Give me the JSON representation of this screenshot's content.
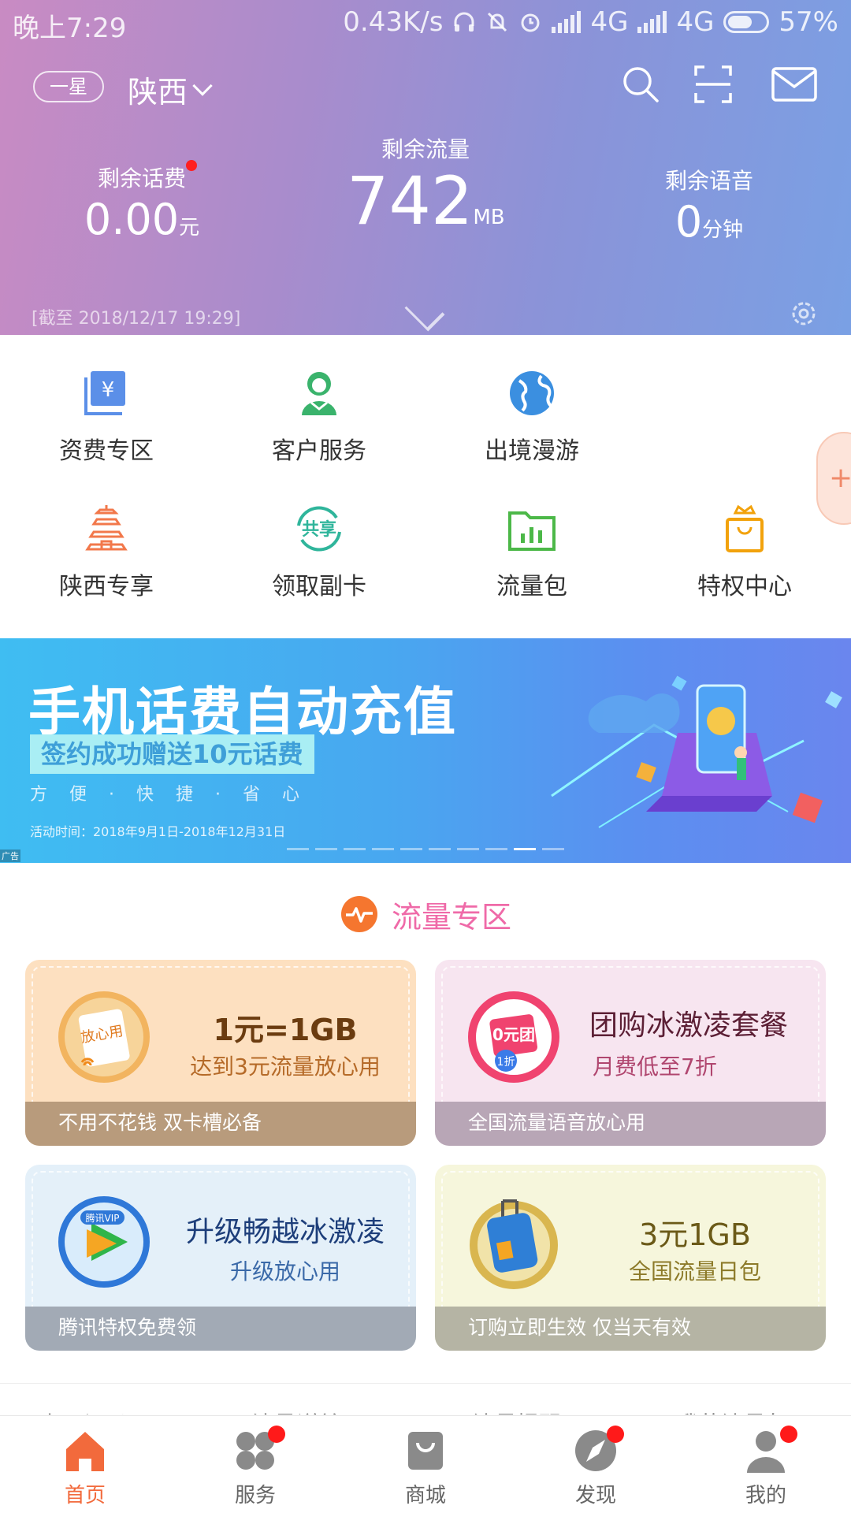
{
  "status_bar": {
    "time": "晚上7:29",
    "speed": "0.43K/s",
    "network1": "4G",
    "network2": "4G",
    "battery": "57%",
    "icons": [
      "headset-icon",
      "mute-icon",
      "alarm-icon",
      "signal-icon",
      "battery-icon"
    ]
  },
  "header": {
    "star_level": "一星",
    "province": "陕西",
    "balance": {
      "label": "剩余话费",
      "value": "0.00",
      "unit": "元"
    },
    "data": {
      "label": "剩余流量",
      "value": "742",
      "unit": "MB"
    },
    "voice": {
      "label": "剩余语音",
      "value": "0",
      "unit": "分钟"
    },
    "as_of": "[截至 2018/12/17 19:29]",
    "icons": [
      "search-icon",
      "scan-icon",
      "mail-icon",
      "settings-icon"
    ]
  },
  "quick_menu": [
    {
      "label": "资费专区",
      "icon": "tariff-icon"
    },
    {
      "label": "客户服务",
      "icon": "customer-service-icon"
    },
    {
      "label": "出境漫游",
      "icon": "globe-icon"
    },
    {
      "label": "陕西专享",
      "icon": "pagoda-icon"
    },
    {
      "label": "领取副卡",
      "icon": "share-card-icon"
    },
    {
      "label": "流量包",
      "icon": "folder-chart-icon"
    },
    {
      "label": "特权中心",
      "icon": "crown-bag-icon"
    }
  ],
  "banner": {
    "title": "手机话费自动充值",
    "subtitle": "签约成功赠送10元话费",
    "tagline": "方便·快捷·省心",
    "date": "活动时间：2018年9月1日-2018年12月31日",
    "ad_label": "广告",
    "slide_count": 10,
    "active_slide": 9
  },
  "flow_zone": {
    "title": "流量专区",
    "cards": [
      {
        "medal_text": "放心用",
        "title": "1元=1GB",
        "subtitle": "达到3元流量放心用",
        "footer": "不用不花钱 双卡槽必备"
      },
      {
        "medal_text": "0元团",
        "medal_sub": "1折",
        "title": "团购冰激凌套餐",
        "subtitle": "月费低至7折",
        "footer": "全国流量语音放心用"
      },
      {
        "medal_text": "腾讯VIP",
        "title": "升级畅越冰激凌",
        "subtitle": "升级放心用",
        "footer": "腾讯特权免费领"
      },
      {
        "title": "3元1GB",
        "subtitle": "全国流量日包",
        "footer": "订购立即生效 仅当天有效"
      }
    ]
  },
  "more_links": [
    "上网记录",
    "流量详单",
    "流量提醒",
    "我的流量包"
  ],
  "bottom_nav": [
    {
      "label": "首页",
      "icon": "home-icon",
      "active": true,
      "badge": false
    },
    {
      "label": "服务",
      "icon": "services-icon",
      "active": false,
      "badge": true
    },
    {
      "label": "商城",
      "icon": "shop-bag-icon",
      "active": false,
      "badge": false
    },
    {
      "label": "发现",
      "icon": "compass-icon",
      "active": false,
      "badge": true
    },
    {
      "label": "我的",
      "icon": "user-icon",
      "active": false,
      "badge": true
    }
  ],
  "colors": {
    "accent": "#f26a3c",
    "flow_title": "#ef6aa8",
    "badge": "#ff1a1a",
    "header_start": "#c98bc3",
    "header_end": "#7aa0e4"
  }
}
